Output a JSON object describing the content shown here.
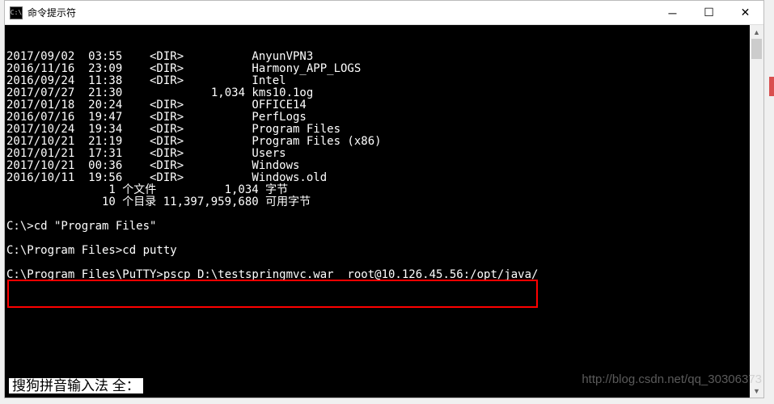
{
  "window": {
    "title": "命令提示符",
    "icon_text": "C:\\"
  },
  "controls": {
    "minimize": "─",
    "maximize": "☐",
    "close": "✕"
  },
  "terminal": {
    "lines": [
      "2017/09/02  03:55    <DIR>          AnyunVPN3",
      "2016/11/16  23:09    <DIR>          Harmony_APP_LOGS",
      "2016/09/24  11:38    <DIR>          Intel",
      "2017/07/27  21:30             1,034 kms10.1og",
      "2017/01/18  20:24    <DIR>          OFFICE14",
      "2016/07/16  19:47    <DIR>          PerfLogs",
      "2017/10/24  19:34    <DIR>          Program Files",
      "2017/10/21  21:19    <DIR>          Program Files (x86)",
      "2017/01/21  17:31    <DIR>          Users",
      "2017/10/21  00:36    <DIR>          Windows",
      "2016/10/11  19:56    <DIR>          Windows.old",
      "               1 个文件          1,034 字节",
      "              10 个目录 11,397,959,680 可用字节",
      "",
      "C:\\>cd \"Program Files\"",
      "",
      "C:\\Program Files>cd putty",
      "",
      "C:\\Program Files\\PuTTY>pscp D:\\testspringmvc.war  root@10.126.45.56:/opt/java/"
    ]
  },
  "ime": {
    "text": "搜狗拼音输入法 全："
  },
  "watermark": {
    "text": "http://blog.csdn.net/qq_30306373"
  },
  "scrollbar": {
    "up": "▲",
    "down": "▼"
  }
}
